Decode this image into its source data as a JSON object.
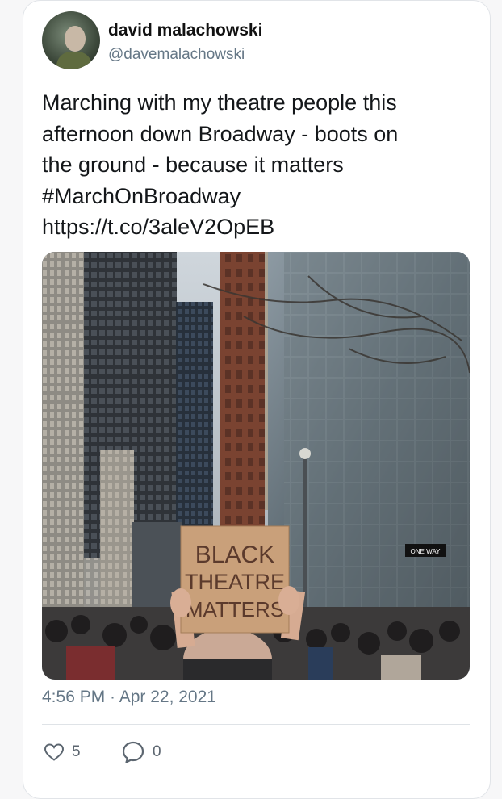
{
  "author": {
    "name": "david malachowski",
    "handle": "@davemalachowski"
  },
  "tweet": {
    "lines": [
      "Marching with my theatre people this",
      "afternoon down Broadway - boots on",
      "the ground - because it matters",
      "#MarchOnBroadway",
      "https://t.co/3aleV2OpEB"
    ],
    "timestamp": "4:56 PM · Apr 22, 2021"
  },
  "media": {
    "sign_lines": [
      "BLACK",
      "THEATRE",
      "MATTERS"
    ],
    "street_sign": "ONE WAY"
  },
  "actions": {
    "like_count": "5",
    "reply_count": "0"
  },
  "colors": {
    "text": "#14171a",
    "secondary": "#657786",
    "sign": "#c9a07a"
  }
}
